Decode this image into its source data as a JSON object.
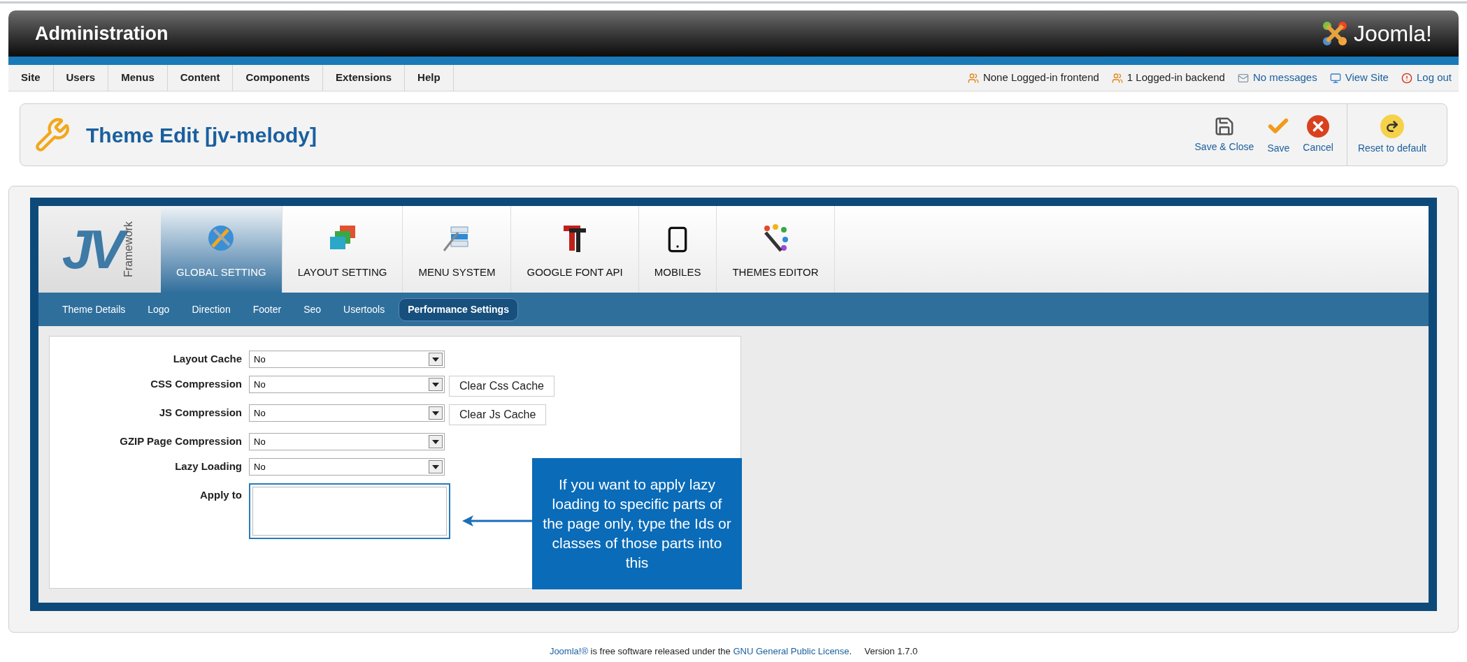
{
  "header": {
    "title": "Administration",
    "logo_text": "Joomla!"
  },
  "menu": [
    "Site",
    "Users",
    "Menus",
    "Content",
    "Components",
    "Extensions",
    "Help"
  ],
  "status": [
    {
      "kind": "user",
      "text": "None Logged-in frontend",
      "link": false
    },
    {
      "kind": "user",
      "text": "1 Logged-in backend",
      "link": false
    },
    {
      "kind": "mail",
      "text": "No messages",
      "link": true
    },
    {
      "kind": "screen",
      "text": "View Site",
      "link": true
    },
    {
      "kind": "logout",
      "text": "Log out",
      "link": true
    }
  ],
  "toolbar": {
    "title": "Theme Edit [jv-melody]",
    "buttons": [
      {
        "kind": "save-close",
        "label": "Save & Close"
      },
      {
        "kind": "save",
        "label": "Save"
      },
      {
        "kind": "cancel",
        "label": "Cancel"
      },
      {
        "kind": "reset",
        "label": "Reset to default"
      }
    ]
  },
  "framework_logo": {
    "letters": "JV",
    "word": "Framework"
  },
  "tabs": [
    {
      "kind": "global",
      "label": "GLOBAL SETTING",
      "selected": true
    },
    {
      "kind": "layout",
      "label": "LAYOUT SETTING",
      "selected": false
    },
    {
      "kind": "menu",
      "label": "MENU SYSTEM",
      "selected": false
    },
    {
      "kind": "font",
      "label": "GOOGLE FONT API",
      "selected": false
    },
    {
      "kind": "mobile",
      "label": "MOBILES",
      "selected": false
    },
    {
      "kind": "editor",
      "label": "THEMES EDITOR",
      "selected": false
    }
  ],
  "subtabs": [
    {
      "label": "Theme Details",
      "selected": false
    },
    {
      "label": "Logo",
      "selected": false
    },
    {
      "label": "Direction",
      "selected": false
    },
    {
      "label": "Footer",
      "selected": false
    },
    {
      "label": "Seo",
      "selected": false
    },
    {
      "label": "Usertools",
      "selected": false
    },
    {
      "label": "Performance Settings",
      "selected": true
    }
  ],
  "fields": [
    {
      "kind": "select",
      "label": "Layout Cache",
      "value": "No"
    },
    {
      "kind": "select",
      "label": "CSS Compression",
      "value": "No",
      "button": "Clear Css Cache"
    },
    {
      "kind": "select",
      "label": "JS Compression",
      "value": "No",
      "button": "Clear Js Cache"
    },
    {
      "kind": "select",
      "label": "GZIP Page Compression",
      "value": "No"
    },
    {
      "kind": "select",
      "label": "Lazy Loading",
      "value": "No"
    },
    {
      "kind": "textarea",
      "label": "Apply to",
      "focused": true
    }
  ],
  "callout": "If you want to apply lazy loading to specific parts of the page only, type the Ids or classes of those parts into this",
  "footer": {
    "link": "Joomla!®",
    "text": " is free software released under the ",
    "license": "GNU General Public License",
    "end": ".",
    "version": "Version 1.7.0"
  }
}
